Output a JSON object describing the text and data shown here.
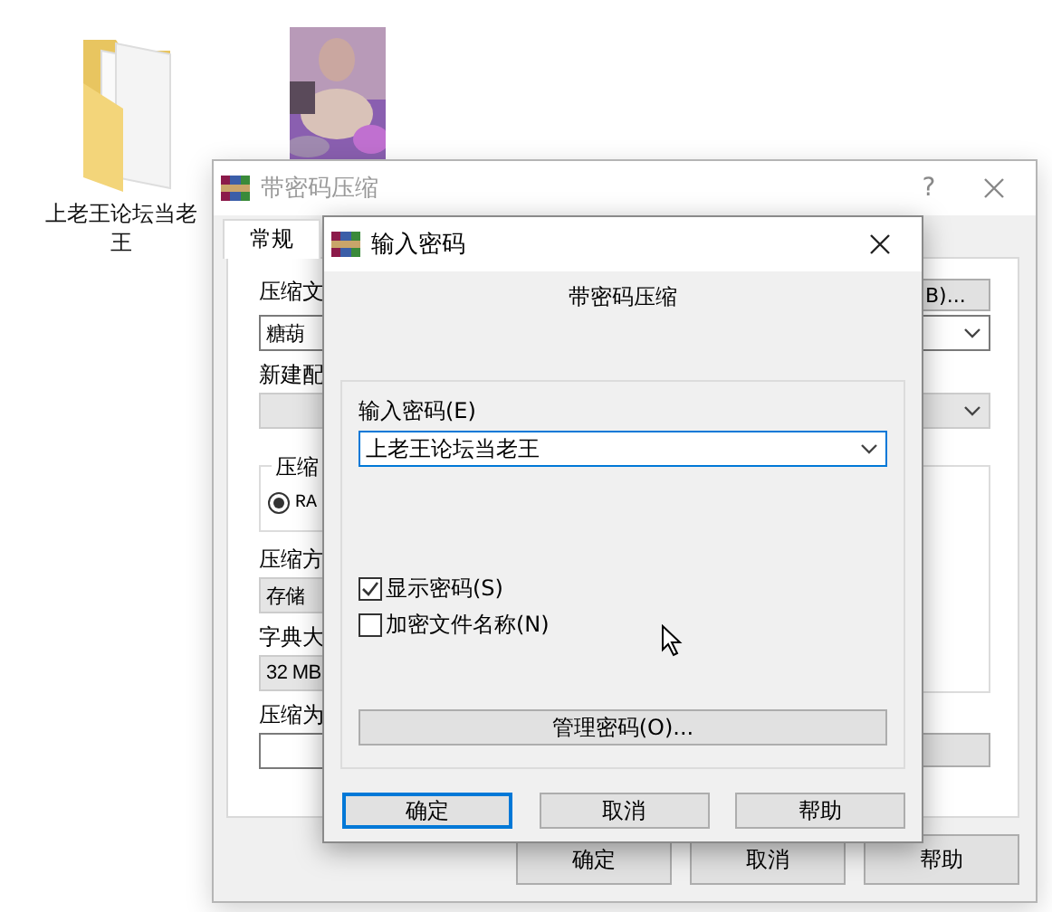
{
  "desktop_icons": [
    {
      "kind": "folder",
      "label": "上老王论坛当老王"
    },
    {
      "kind": "picture"
    }
  ],
  "back_window": {
    "title": "带密码压缩",
    "active": false,
    "help": "?",
    "tabs": [
      {
        "label": "常规",
        "selected": true
      }
    ],
    "left": [
      {
        "kind": "label",
        "text": "压缩文"
      },
      {
        "kind": "combo",
        "value": "糖葫",
        "disabled": false
      },
      {
        "kind": "label",
        "text": "新建配"
      },
      {
        "kind": "combo",
        "disabled": true
      }
    ],
    "top_button": "B)...",
    "group": {
      "label": "压缩",
      "radio": {
        "label": "RA",
        "selected": true
      }
    },
    "lower": [
      {
        "kind": "label",
        "text": "压缩方"
      },
      {
        "kind": "combo",
        "value": "存储",
        "disabled": true
      },
      {
        "kind": "label",
        "text": "字典大"
      },
      {
        "kind": "combo",
        "value": "32 MB",
        "disabled": true
      },
      {
        "kind": "label",
        "text": "压缩为"
      },
      {
        "kind": "field"
      }
    ],
    "buttons": [
      {
        "label": "确定"
      },
      {
        "label": "取消"
      },
      {
        "label": "帮助"
      }
    ]
  },
  "dialog": {
    "title": "输入密码",
    "active": true,
    "heading": "带密码压缩",
    "password_label": "输入密码(E)",
    "password_value": "上老王论坛当老王",
    "options": [
      {
        "label": "显示密码(S)",
        "checked": true
      },
      {
        "label": "加密文件名称(N)",
        "checked": false
      }
    ],
    "manage_button": "管理密码(O)...",
    "buttons": [
      {
        "label": "确定",
        "default": true
      },
      {
        "label": "取消",
        "default": false
      },
      {
        "label": "帮助",
        "default": false
      }
    ]
  }
}
